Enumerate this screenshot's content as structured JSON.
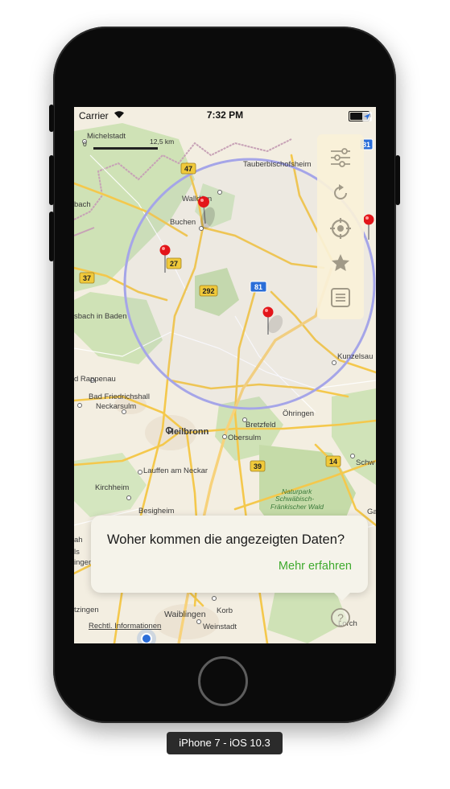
{
  "device_label": "iPhone 7 - iOS 10.3",
  "status_bar": {
    "carrier": "Carrier",
    "time": "7:32 PM",
    "battery_level": 1.0
  },
  "map": {
    "scale": {
      "start_label": "0",
      "end_label": "12,5 km"
    },
    "road_labels": [
      "47",
      "81",
      "27",
      "292",
      "37",
      "39",
      "14",
      "81"
    ],
    "place_labels": [
      "Michelstadt",
      "Tauberbischofsheim",
      "Walldürn",
      "Buchen",
      "bach",
      "sbach in Baden",
      "Kunzelsau",
      "d Rappenau",
      "Bad Friedrichshall",
      "Neckarsulm",
      "Öhringen",
      "Bretzfeld",
      "Heilbronn",
      "Obersulm",
      "Schw",
      "Lauffen am Neckar",
      "Kirchheim",
      "Naturpark",
      "Schwäbisch-",
      "Fränkischer Wald",
      "Besigheim",
      "Gai",
      "ah",
      "ls",
      "ingen",
      "tzingen",
      "Waiblingen",
      "Korb",
      "Weinstadt",
      "Lorch",
      "Rechtl. Informationen"
    ]
  },
  "toolbar": {
    "items": [
      {
        "icon": "sliders-icon",
        "name": "filter-settings"
      },
      {
        "icon": "refresh-icon",
        "name": "refresh"
      },
      {
        "icon": "crosshair-icon",
        "name": "locate"
      },
      {
        "icon": "star-icon",
        "name": "favorites"
      },
      {
        "icon": "list-icon",
        "name": "list"
      }
    ]
  },
  "info_card": {
    "question": "Woher kommen die angezeigten Daten?",
    "more_link": "Mehr erfahren"
  },
  "help_button": {
    "glyph": "?"
  },
  "colors": {
    "accent_green": "#3faa2e",
    "pin_red": "#e3151a",
    "radius_circle": "#9c9ce6",
    "road_yellow": "#f4c84c",
    "road_badge": "#f0c93a",
    "forest_green": "#c9dfb0"
  }
}
